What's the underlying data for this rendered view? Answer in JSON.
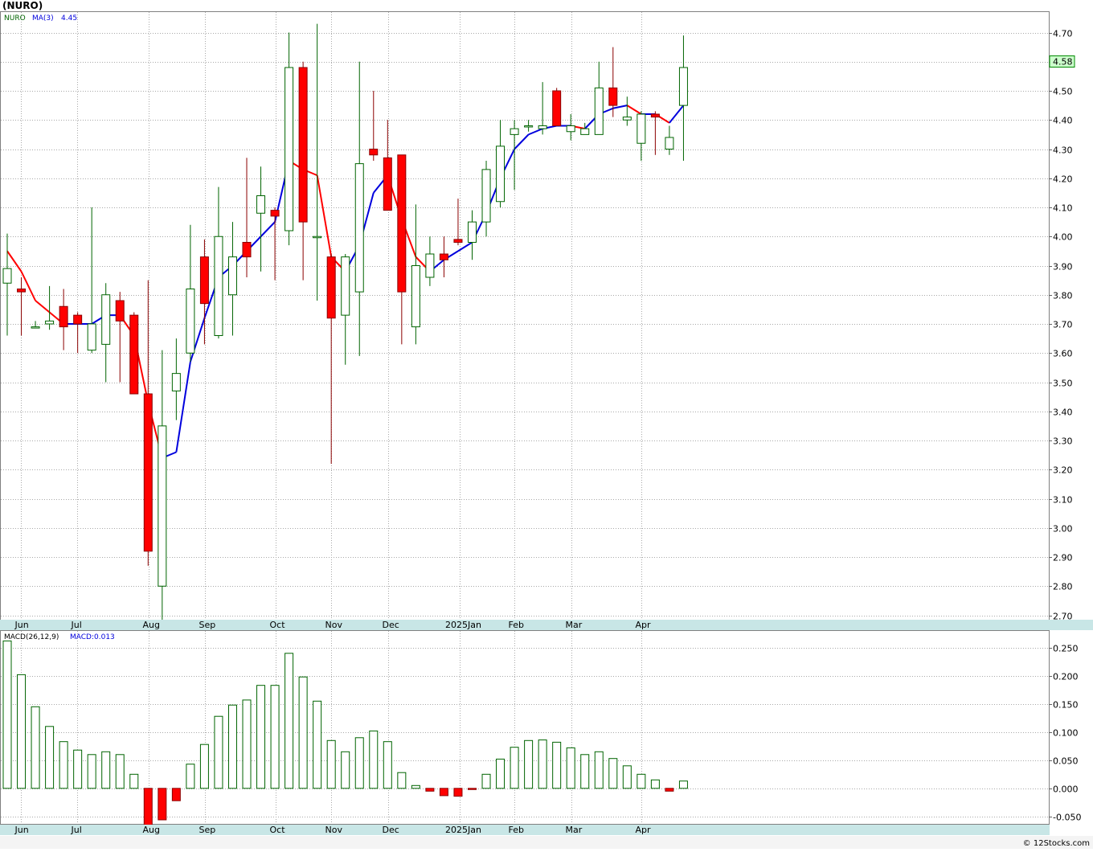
{
  "header": {
    "symbol_title": "(NURO)"
  },
  "price_panel": {
    "ticker_label": "NURO",
    "ma_label": "MA(3)",
    "ma_value": "4.45",
    "last_price_badge": "4.58"
  },
  "macd_panel": {
    "label": "MACD(26,12,9)",
    "value_label": "MACD:0.013"
  },
  "footer": {
    "copyright": "© 12Stocks.com"
  },
  "colors": {
    "up_candle_border": "#006400",
    "down_candle_fill": "#ff0000",
    "ma_up": "#0000dd",
    "ma_down": "#ff0000",
    "macd_bar": "#006400",
    "macd_negative_fill": "#ff0000",
    "time_axis_band": "#c8e6e6",
    "badge_fill": "#ccffcc"
  },
  "chart_data": [
    {
      "type": "candlestick",
      "title": "(NURO)",
      "interval": "weekly",
      "month_labels": [
        "Jun",
        "Jul",
        "Aug",
        "Sep",
        "Oct",
        "Nov",
        "Dec",
        "2025Jan",
        "Feb",
        "Mar",
        "Apr"
      ],
      "y_ticks": [
        "2.70",
        "2.80",
        "2.90",
        "3.00",
        "3.10",
        "3.20",
        "3.30",
        "3.40",
        "3.50",
        "3.60",
        "3.70",
        "3.80",
        "3.90",
        "4.00",
        "4.10",
        "4.20",
        "4.30",
        "4.40",
        "4.50",
        "4.60",
        "4.70"
      ],
      "ylim": [
        2.64,
        4.74
      ],
      "grid": true,
      "candles": [
        {
          "o": 3.84,
          "h": 4.01,
          "l": 3.66,
          "c": 3.89
        },
        {
          "o": 3.82,
          "h": 3.86,
          "l": 3.66,
          "c": 3.81
        },
        {
          "o": 3.69,
          "h": 3.71,
          "l": 3.69,
          "c": 3.69
        },
        {
          "o": 3.7,
          "h": 3.83,
          "l": 3.68,
          "c": 3.71
        },
        {
          "o": 3.76,
          "h": 3.82,
          "l": 3.61,
          "c": 3.69
        },
        {
          "o": 3.73,
          "h": 3.74,
          "l": 3.6,
          "c": 3.7
        },
        {
          "o": 3.61,
          "h": 4.1,
          "l": 3.6,
          "c": 3.7
        },
        {
          "o": 3.63,
          "h": 3.84,
          "l": 3.5,
          "c": 3.8
        },
        {
          "o": 3.78,
          "h": 3.81,
          "l": 3.5,
          "c": 3.71
        },
        {
          "o": 3.73,
          "h": 3.74,
          "l": 3.46,
          "c": 3.46
        },
        {
          "o": 3.46,
          "h": 3.85,
          "l": 2.87,
          "c": 2.92
        },
        {
          "o": 2.8,
          "h": 3.61,
          "l": 2.65,
          "c": 3.35
        },
        {
          "o": 3.47,
          "h": 3.65,
          "l": 3.37,
          "c": 3.53
        },
        {
          "o": 3.6,
          "h": 4.04,
          "l": 3.57,
          "c": 3.82
        },
        {
          "o": 3.93,
          "h": 3.99,
          "l": 3.63,
          "c": 3.77
        },
        {
          "o": 3.66,
          "h": 4.17,
          "l": 3.65,
          "c": 4.0
        },
        {
          "o": 3.8,
          "h": 4.05,
          "l": 3.66,
          "c": 3.93
        },
        {
          "o": 3.98,
          "h": 4.27,
          "l": 3.86,
          "c": 3.93
        },
        {
          "o": 4.08,
          "h": 4.24,
          "l": 3.88,
          "c": 4.14
        },
        {
          "o": 4.09,
          "h": 4.1,
          "l": 3.85,
          "c": 4.07
        },
        {
          "o": 4.02,
          "h": 4.7,
          "l": 3.97,
          "c": 4.58
        },
        {
          "o": 4.58,
          "h": 4.6,
          "l": 3.85,
          "c": 4.05
        },
        {
          "o": 4.0,
          "h": 4.73,
          "l": 3.78,
          "c": 4.0
        },
        {
          "o": 3.93,
          "h": 3.94,
          "l": 3.22,
          "c": 3.72
        },
        {
          "o": 3.73,
          "h": 3.94,
          "l": 3.56,
          "c": 3.93
        },
        {
          "o": 3.81,
          "h": 4.6,
          "l": 3.59,
          "c": 4.25
        },
        {
          "o": 4.3,
          "h": 4.5,
          "l": 4.26,
          "c": 4.28
        },
        {
          "o": 4.27,
          "h": 4.4,
          "l": 4.09,
          "c": 4.09
        },
        {
          "o": 4.28,
          "h": 4.28,
          "l": 3.63,
          "c": 3.81
        },
        {
          "o": 3.69,
          "h": 4.11,
          "l": 3.63,
          "c": 3.9
        },
        {
          "o": 3.86,
          "h": 4.0,
          "l": 3.83,
          "c": 3.94
        },
        {
          "o": 3.94,
          "h": 4.0,
          "l": 3.86,
          "c": 3.92
        },
        {
          "o": 3.99,
          "h": 4.13,
          "l": 3.97,
          "c": 3.98
        },
        {
          "o": 3.98,
          "h": 4.09,
          "l": 3.92,
          "c": 4.05
        },
        {
          "o": 4.05,
          "h": 4.26,
          "l": 4.0,
          "c": 4.23
        },
        {
          "o": 4.12,
          "h": 4.4,
          "l": 4.1,
          "c": 4.31
        },
        {
          "o": 4.35,
          "h": 4.4,
          "l": 4.16,
          "c": 4.37
        },
        {
          "o": 4.38,
          "h": 4.4,
          "l": 4.36,
          "c": 4.38
        },
        {
          "o": 4.37,
          "h": 4.53,
          "l": 4.35,
          "c": 4.38
        },
        {
          "o": 4.5,
          "h": 4.51,
          "l": 4.38,
          "c": 4.38
        },
        {
          "o": 4.36,
          "h": 4.42,
          "l": 4.33,
          "c": 4.38
        },
        {
          "o": 4.35,
          "h": 4.39,
          "l": 4.35,
          "c": 4.37
        },
        {
          "o": 4.35,
          "h": 4.6,
          "l": 4.35,
          "c": 4.51
        },
        {
          "o": 4.51,
          "h": 4.65,
          "l": 4.41,
          "c": 4.45
        },
        {
          "o": 4.4,
          "h": 4.48,
          "l": 4.38,
          "c": 4.41
        },
        {
          "o": 4.32,
          "h": 4.43,
          "l": 4.26,
          "c": 4.42
        },
        {
          "o": 4.42,
          "h": 4.43,
          "l": 4.28,
          "c": 4.41
        },
        {
          "o": 4.3,
          "h": 4.38,
          "l": 4.28,
          "c": 4.34
        },
        {
          "o": 4.45,
          "h": 4.69,
          "l": 4.26,
          "c": 4.58
        }
      ],
      "ma3": {
        "name": "MA(3)",
        "values": [
          3.95,
          3.88,
          3.78,
          3.74,
          3.7,
          3.7,
          3.7,
          3.73,
          3.73,
          3.66,
          3.43,
          3.24,
          3.26,
          3.57,
          3.72,
          3.86,
          3.9,
          3.95,
          4.0,
          4.05,
          4.26,
          4.23,
          4.21,
          3.93,
          3.88,
          3.97,
          4.15,
          4.21,
          4.06,
          3.93,
          3.88,
          3.92,
          3.95,
          3.98,
          4.08,
          4.2,
          4.3,
          4.35,
          4.37,
          4.38,
          4.38,
          4.37,
          4.42,
          4.44,
          4.45,
          4.42,
          4.42,
          4.39,
          4.45
        ]
      }
    },
    {
      "type": "bar",
      "title": "MACD(26,12,9)",
      "y_ticks": [
        "-0.050",
        "0.000",
        "0.050",
        "0.100",
        "0.150",
        "0.200",
        "0.250"
      ],
      "ylim": [
        -0.065,
        0.262
      ],
      "grid": true,
      "month_labels": [
        "Jun",
        "Jul",
        "Aug",
        "Sep",
        "Oct",
        "Nov",
        "Dec",
        "2025Jan",
        "Feb",
        "Mar",
        "Apr"
      ],
      "values": [
        0.262,
        0.202,
        0.145,
        0.11,
        0.083,
        0.068,
        0.06,
        0.065,
        0.06,
        0.025,
        -0.065,
        -0.056,
        -0.022,
        0.043,
        0.078,
        0.128,
        0.148,
        0.157,
        0.183,
        0.183,
        0.24,
        0.198,
        0.155,
        0.085,
        0.065,
        0.09,
        0.102,
        0.083,
        0.028,
        0.005,
        -0.005,
        -0.013,
        -0.014,
        -0.002,
        0.025,
        0.052,
        0.073,
        0.085,
        0.086,
        0.082,
        0.072,
        0.06,
        0.065,
        0.053,
        0.04,
        0.025,
        0.015,
        -0.005,
        0.013
      ]
    }
  ]
}
